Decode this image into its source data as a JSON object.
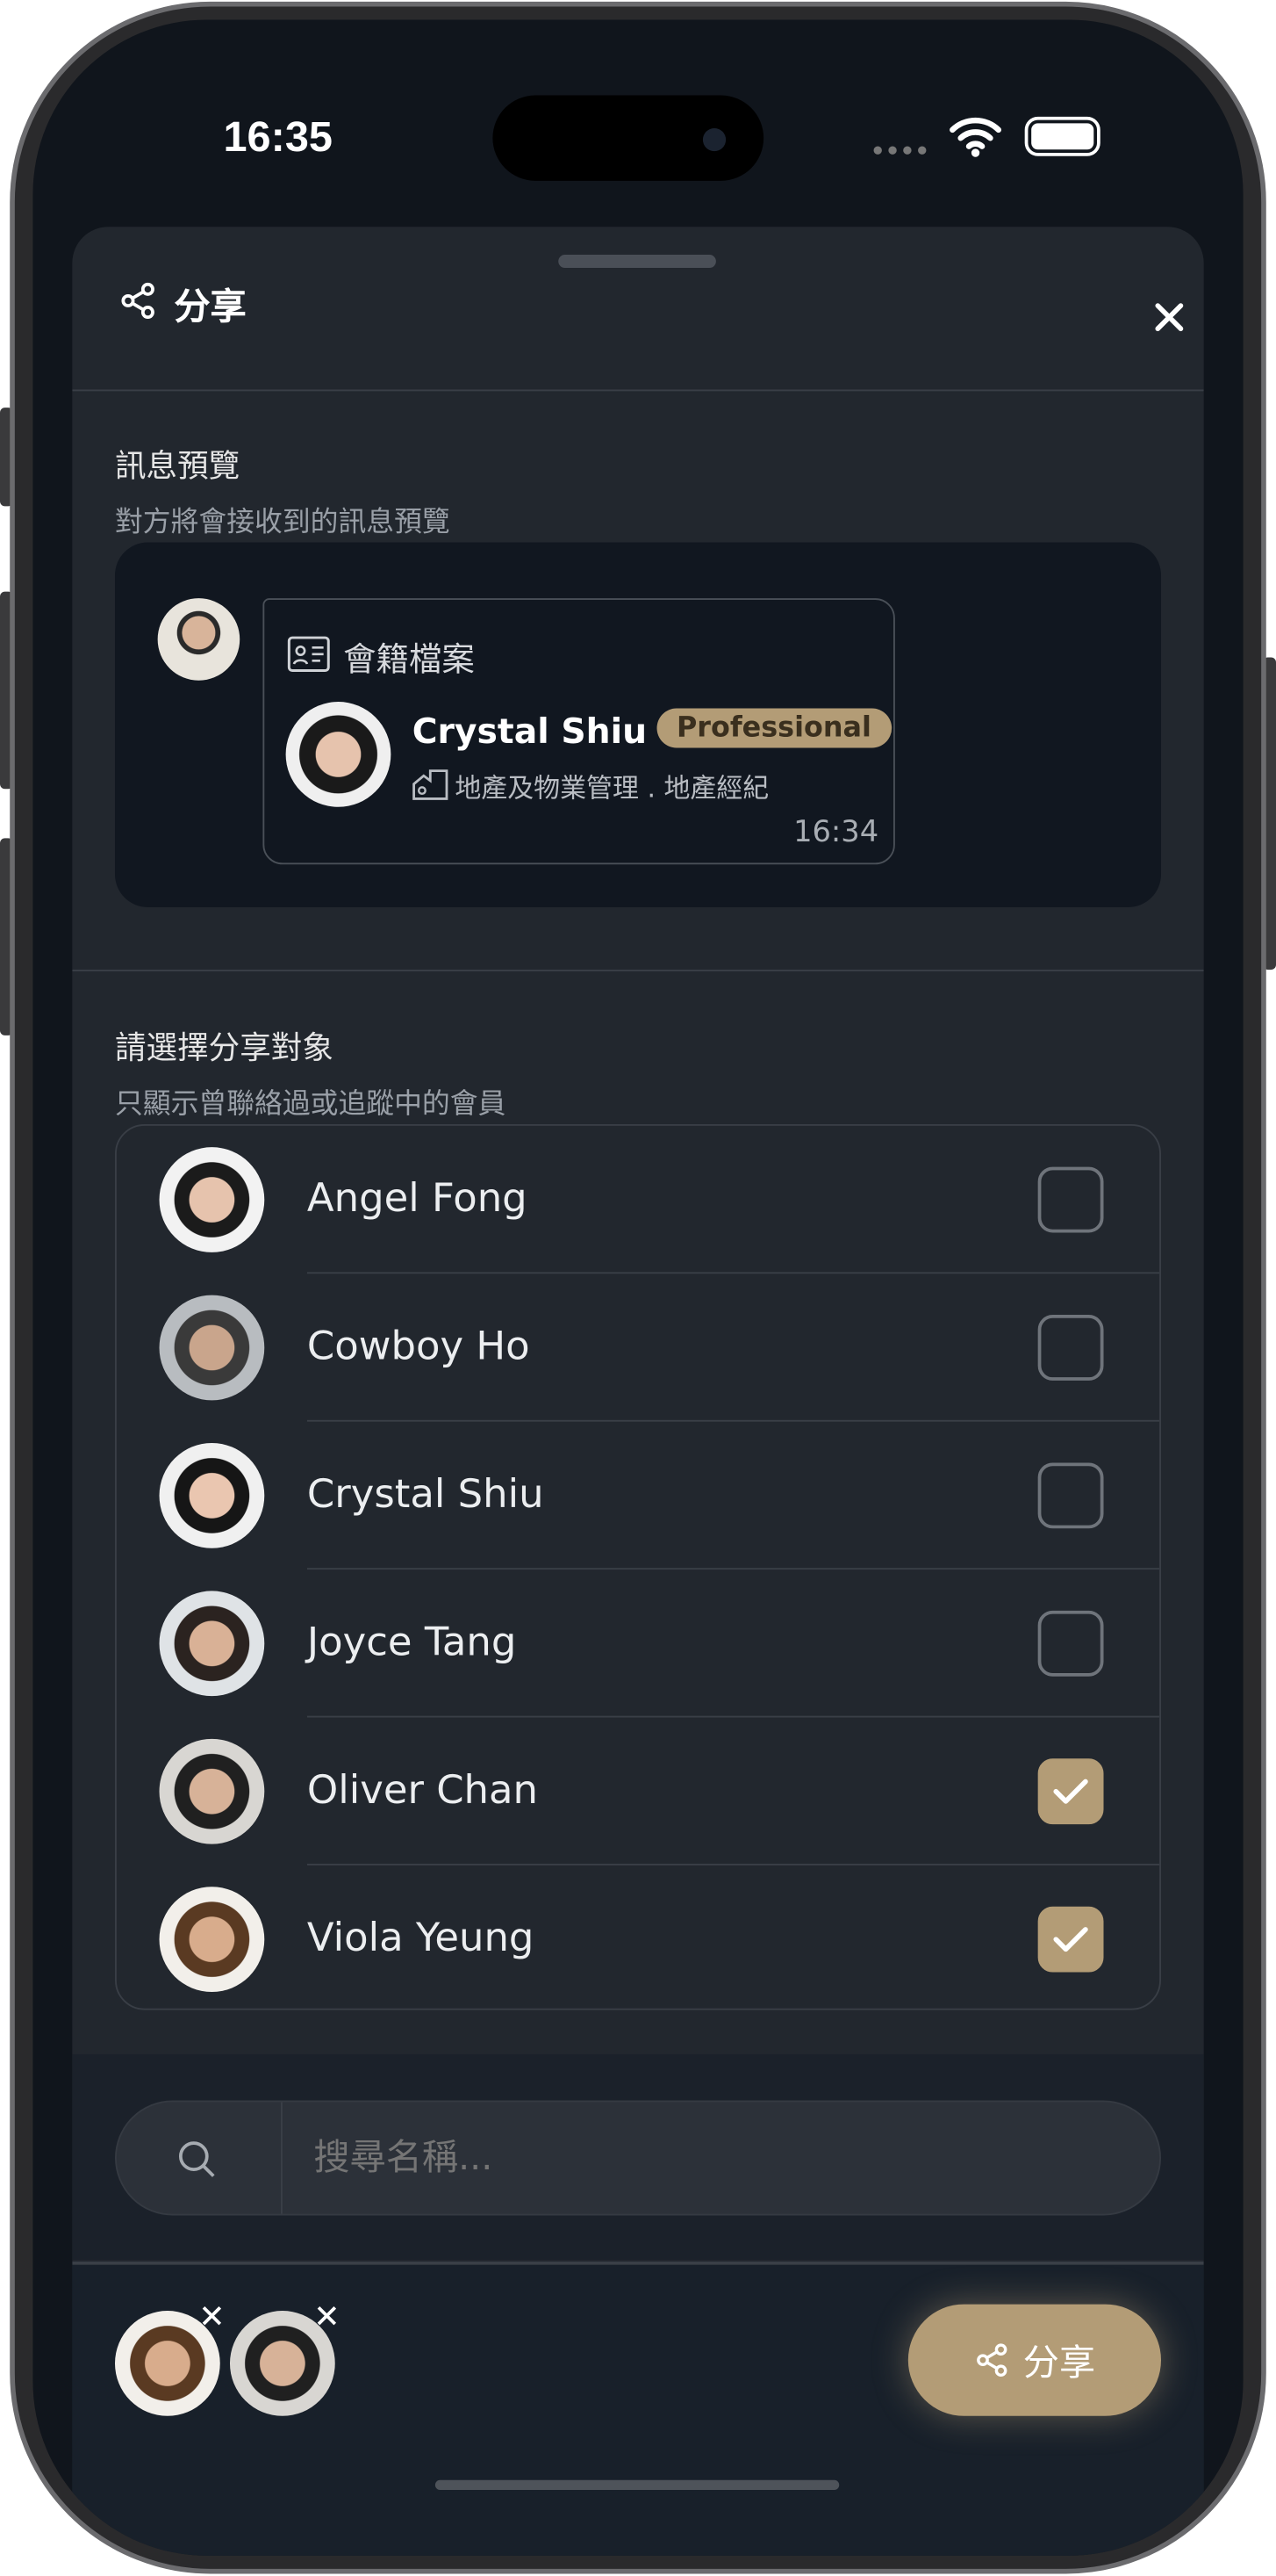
{
  "status": {
    "time": "16:35"
  },
  "header": {
    "title": "分享",
    "icon": "share-icon",
    "close_icon": "close-icon"
  },
  "preview": {
    "title": "訊息預覽",
    "subtitle": "對方將會接收到的訊息預覽",
    "card_label": "會籍檔案",
    "member_name": "Crystal Shiu",
    "member_badge": "Professional",
    "member_industry": "地產及物業管理 . 地產經紀",
    "timestamp": "16:34"
  },
  "recipients": {
    "title": "請選擇分享對象",
    "subtitle": "只顯示曾聯絡過或追蹤中的會員",
    "items": [
      {
        "name": "Angel Fong",
        "checked": false
      },
      {
        "name": "Cowboy Ho",
        "checked": false
      },
      {
        "name": "Crystal Shiu",
        "checked": false
      },
      {
        "name": "Joyce Tang",
        "checked": false
      },
      {
        "name": "Oliver Chan",
        "checked": true
      },
      {
        "name": "Viola Yeung",
        "checked": true
      }
    ]
  },
  "search": {
    "placeholder": "搜尋名稱..."
  },
  "selected": [
    "Viola Yeung",
    "Oliver Chan"
  ],
  "footer": {
    "share_label": "分享"
  },
  "colors": {
    "accent": "#b39c76",
    "sheet": "#22272e",
    "card": "#111720"
  }
}
